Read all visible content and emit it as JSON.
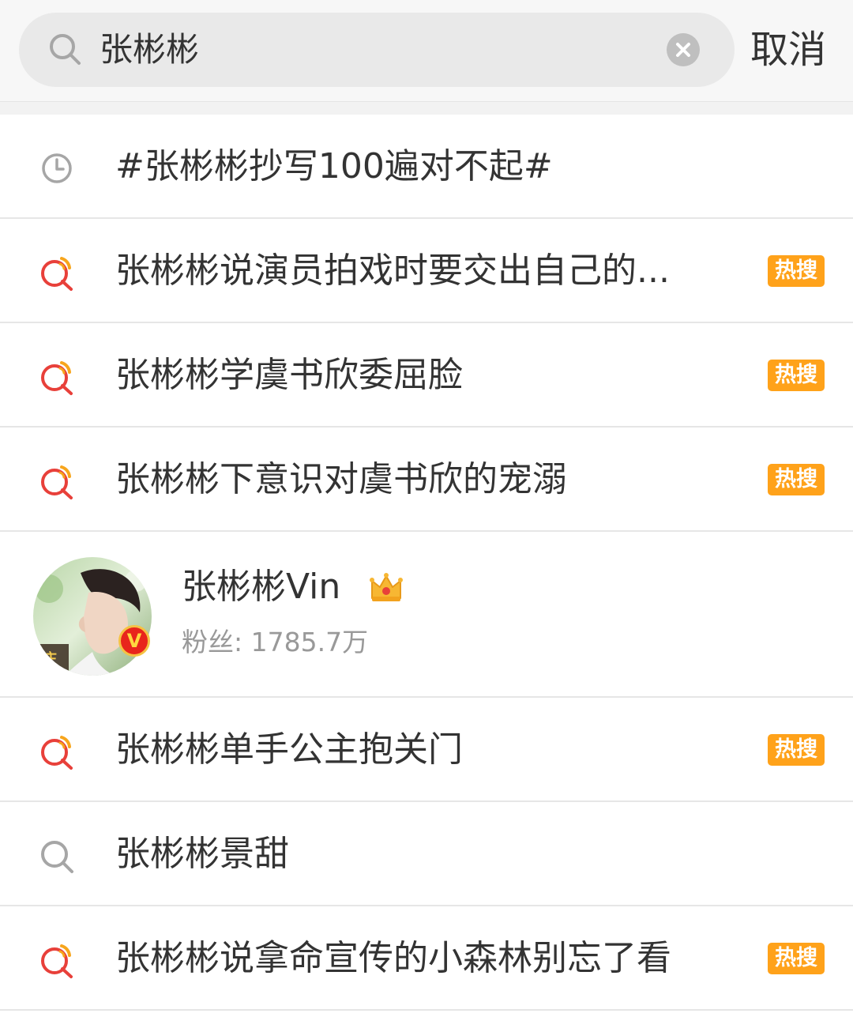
{
  "search": {
    "query": "张彬彬",
    "cancel_label": "取消"
  },
  "suggestions": [
    {
      "type": "history",
      "icon": "clock-icon",
      "text": "#张彬彬抄写100遍对不起#",
      "badge": ""
    },
    {
      "type": "hot",
      "icon": "hot-search-icon",
      "text": "张彬彬说演员拍戏时要交出自己的...",
      "badge": "热搜"
    },
    {
      "type": "hot",
      "icon": "hot-search-icon",
      "text": "张彬彬学虞书欣委屈脸",
      "badge": "热搜"
    },
    {
      "type": "hot",
      "icon": "hot-search-icon",
      "text": "张彬彬下意识对虞书欣的宠溺",
      "badge": "热搜"
    },
    {
      "type": "user",
      "name": "张彬彬Vin",
      "fans": "粉丝: 1785.7万",
      "verified_mark": "V"
    },
    {
      "type": "hot",
      "icon": "hot-search-icon",
      "text": "张彬彬单手公主抱关门",
      "badge": "热搜"
    },
    {
      "type": "plain",
      "icon": "search-icon",
      "text": "张彬彬景甜",
      "badge": ""
    },
    {
      "type": "hot",
      "icon": "hot-search-icon",
      "text": "张彬彬说拿命宣传的小森林别忘了看",
      "badge": "热搜"
    }
  ],
  "colors": {
    "hot_badge": "#ffa21a",
    "hot_icon_red": "#e8403a",
    "hot_icon_orange": "#f7a51c",
    "muted_icon": "#a6a6a6"
  }
}
